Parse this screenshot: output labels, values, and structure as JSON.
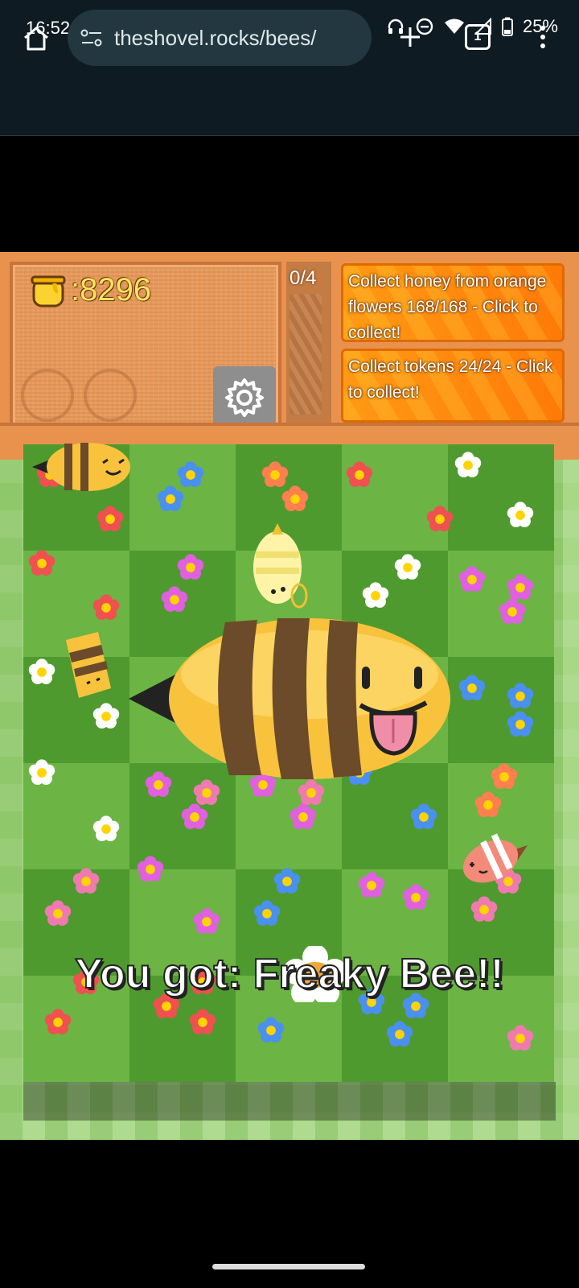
{
  "status": {
    "time": "16:52",
    "battery": "25%"
  },
  "browser": {
    "url": "theshovel.rocks/bees/",
    "tab_count": "1"
  },
  "game": {
    "honey": ":8296",
    "quest_progress": "0/4",
    "quests": [
      {
        "text": "Collect honey from orange flowers 168/168 - Click to collect!"
      },
      {
        "text": "Collect tokens 24/24 - Click to collect!"
      }
    ],
    "result_message": "You got: Freaky Bee!!"
  },
  "icons": {
    "home": "home-icon",
    "tune": "tune-icon",
    "new_tab": "plus-icon",
    "menu": "more-vert-icon",
    "settings": "gear-icon",
    "honey": "honey-pot-icon"
  },
  "colors": {
    "chrome_bg": "#0f1b22",
    "hud_orange": "#e9924e",
    "quest_orange": "#ff8c10",
    "grass_dark": "#4e9a2e",
    "grass_light": "#6cb444",
    "honey_yellow": "#fde45d"
  }
}
